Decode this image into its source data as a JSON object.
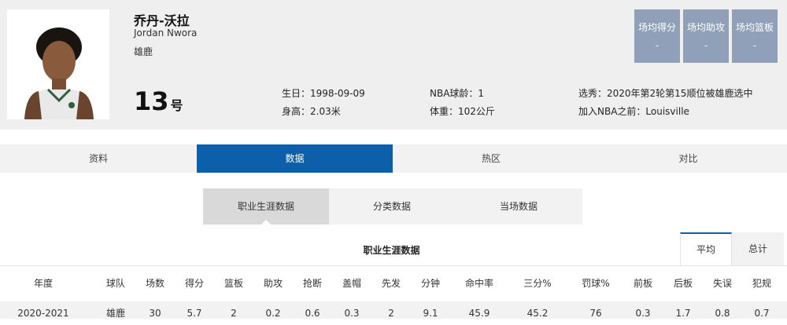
{
  "player": {
    "name_cn": "乔丹-沃拉",
    "name_en": "Jordan Nwora",
    "team": "雄鹿",
    "number": "13",
    "number_suffix": "号"
  },
  "info": {
    "birthday": "生日：1998-09-09",
    "height": "身高：2.03米",
    "nba_years": "NBA球龄：1",
    "weight": "体重：102公斤",
    "draft": "选秀：2020年第2轮第15顺位被雄鹿选中",
    "pre_nba": "加入NBA之前：Louisville"
  },
  "stat_boxes": [
    {
      "label": "场均得分",
      "value": "-"
    },
    {
      "label": "场均助攻",
      "value": "-"
    },
    {
      "label": "场均篮板",
      "value": "-"
    }
  ],
  "tabs": [
    "资料",
    "数据",
    "热区",
    "对比"
  ],
  "subtabs": [
    "职业生涯数据",
    "分类数据",
    "当场数据"
  ],
  "table": {
    "title": "职业生涯数据",
    "mode_avg": "平均",
    "mode_total": "总计",
    "headers": [
      "年度",
      "球队",
      "场数",
      "得分",
      "篮板",
      "助攻",
      "抢断",
      "盖帽",
      "先发",
      "分钟",
      "命中率",
      "三分%",
      "罚球%",
      "前板",
      "后板",
      "失误",
      "犯规"
    ],
    "rows": [
      [
        "2020-2021",
        "雄鹿",
        "30",
        "5.7",
        "2",
        "0.2",
        "0.6",
        "0.3",
        "2",
        "9.1",
        "45.9",
        "45.2",
        "76",
        "0.3",
        "1.7",
        "0.8",
        "0.7"
      ]
    ]
  },
  "colors": {
    "active_tab": "#0c5fa8",
    "stat_box": "#8fa0b8"
  }
}
